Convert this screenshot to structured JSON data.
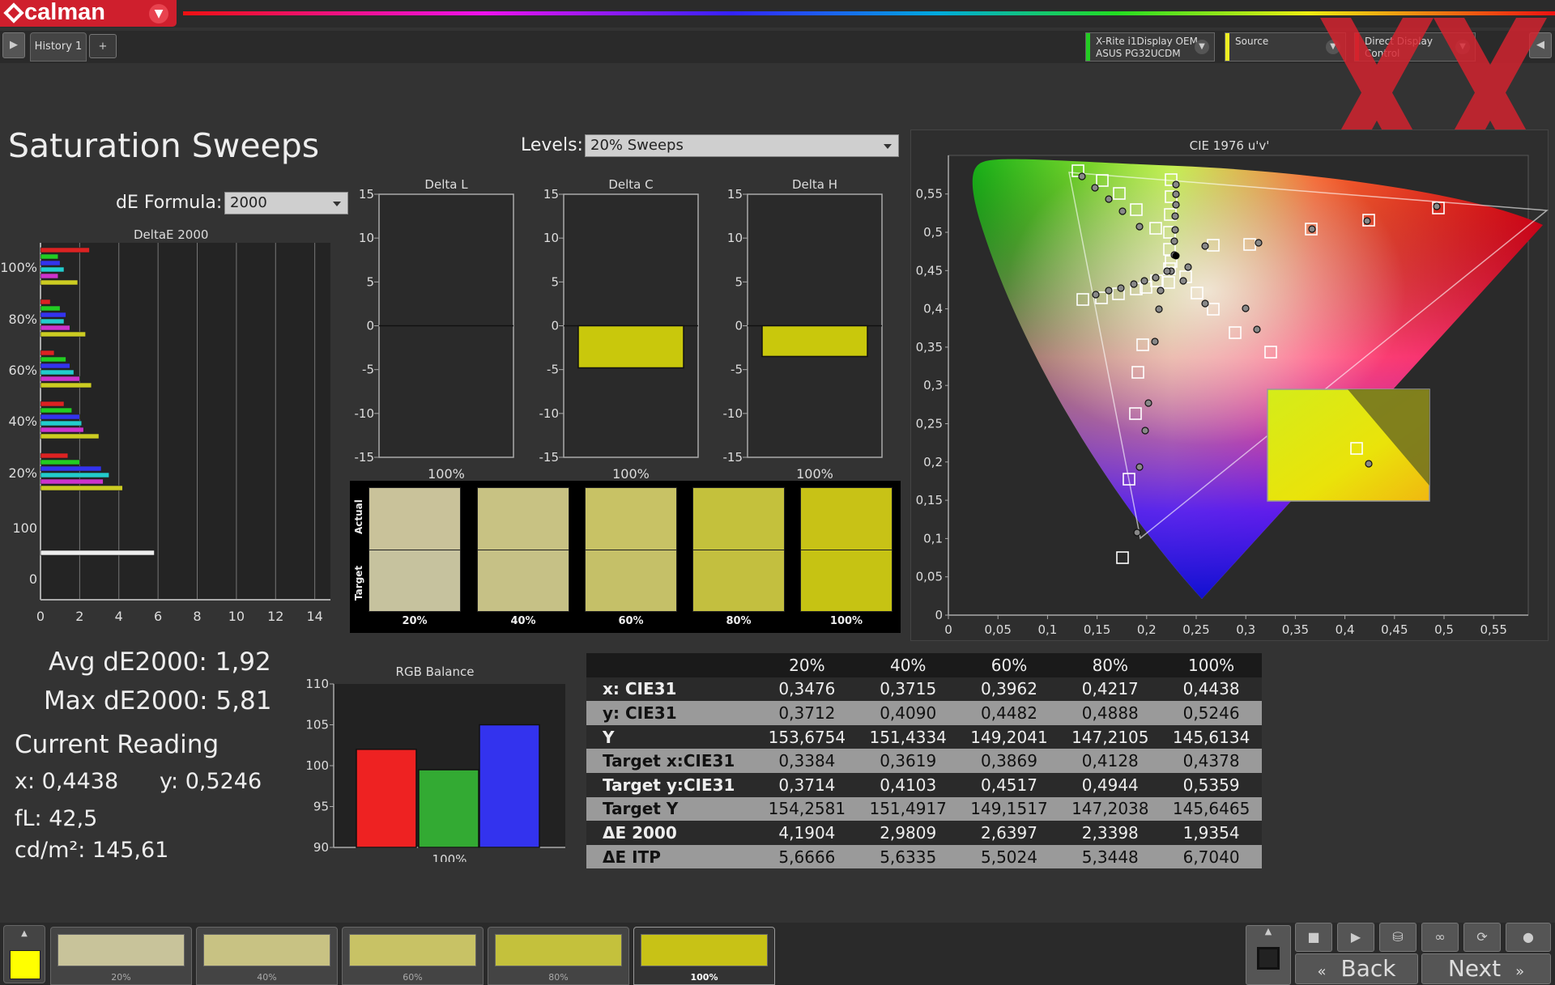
{
  "app": {
    "brand": "calman",
    "tab": "History 1",
    "tab_add": "+"
  },
  "devices": [
    {
      "line1": "X-Rite i1Display OEM",
      "line2": "ASUS PG32UCDM",
      "color": "#22cc22"
    },
    {
      "line1": "Source",
      "line2": "",
      "color": "#e8e81c"
    },
    {
      "line1": "Direct Display Control",
      "line2": "",
      "color": "#cc2222"
    }
  ],
  "page": {
    "title": "Saturation Sweeps",
    "levels_label": "Levels:",
    "levels_value": "20% Sweeps",
    "formula_label": "dE Formula:",
    "formula_value": "2000"
  },
  "deltae_chart": {
    "title": "DeltaE 2000",
    "xticks": [
      "0",
      "2",
      "4",
      "6",
      "8",
      "10",
      "12",
      "14"
    ],
    "ylabels": [
      "100%",
      "80%",
      "60%",
      "40%",
      "20%",
      "100",
      "0"
    ],
    "groups": [
      {
        "label": "100%",
        "values": [
          2.5,
          0.9,
          1.0,
          1.2,
          0.9,
          1.9
        ],
        "colors": [
          "#d22",
          "#2c2",
          "#33e",
          "#2cc",
          "#c3c",
          "#cc2"
        ]
      },
      {
        "label": "80%",
        "values": [
          0.5,
          1.0,
          1.3,
          1.2,
          1.5,
          2.3
        ],
        "colors": [
          "#d22",
          "#2c2",
          "#33e",
          "#2cc",
          "#c3c",
          "#cc2"
        ]
      },
      {
        "label": "60%",
        "values": [
          0.7,
          1.3,
          1.5,
          1.7,
          2.0,
          2.6
        ],
        "colors": [
          "#d22",
          "#2c2",
          "#33e",
          "#2cc",
          "#c3c",
          "#cc2"
        ]
      },
      {
        "label": "40%",
        "values": [
          1.2,
          1.6,
          2.0,
          2.1,
          2.2,
          2.98
        ],
        "colors": [
          "#d22",
          "#2c2",
          "#33e",
          "#2cc",
          "#c3c",
          "#cc2"
        ]
      },
      {
        "label": "20%",
        "values": [
          1.4,
          2.0,
          3.1,
          3.5,
          3.2,
          4.19
        ],
        "colors": [
          "#d22",
          "#2c2",
          "#33e",
          "#2cc",
          "#c3c",
          "#cc2"
        ]
      },
      {
        "label": "100",
        "values": [
          5.81
        ],
        "colors": [
          "#eee"
        ]
      }
    ]
  },
  "delta_charts": [
    {
      "title": "Delta L",
      "value": 0.0,
      "label": "100%"
    },
    {
      "title": "Delta C",
      "value": -4.8,
      "label": "100%"
    },
    {
      "title": "Delta H",
      "value": -3.5,
      "label": "100%"
    }
  ],
  "delta_yticks": [
    "15",
    "10",
    "5",
    "0",
    "-5",
    "-10",
    "-15"
  ],
  "swatches": {
    "actual_label": "Actual",
    "target_label": "Target",
    "items": [
      {
        "label": "20%",
        "actual": "#c9c29a",
        "target": "#c6c29e"
      },
      {
        "label": "40%",
        "actual": "#c8c283",
        "target": "#c6c186"
      },
      {
        "label": "60%",
        "actual": "#c8c265",
        "target": "#c5c068"
      },
      {
        "label": "80%",
        "actual": "#c4c13c",
        "target": "#c3bf3f"
      },
      {
        "label": "100%",
        "actual": "#c8c216",
        "target": "#c6c313"
      }
    ]
  },
  "cie": {
    "title": "CIE 1976 u'v'",
    "xticks": [
      "0",
      "0,05",
      "0,1",
      "0,15",
      "0,2",
      "0,25",
      "0,3",
      "0,35",
      "0,4",
      "0,45",
      "0,5",
      "0,55"
    ],
    "yticks": [
      "0",
      "0,05",
      "0,1",
      "0,15",
      "0,2",
      "0,25",
      "0,3",
      "0,35",
      "0,4",
      "0,45",
      "0,5",
      "0,55"
    ]
  },
  "stats": {
    "avg": "Avg dE2000: 1,92",
    "max": "Max dE2000: 5,81",
    "current": "Current Reading",
    "x": "x: 0,4438",
    "y": "y: 0,5246",
    "fl": "fL: 42,5",
    "cd": "cd/m²: 145,61"
  },
  "rgb_balance": {
    "title": "RGB Balance",
    "yticks": [
      "110",
      "105",
      "100",
      "95",
      "90"
    ],
    "xlabel": "100%",
    "values": [
      {
        "name": "R",
        "value": 102,
        "color": "#e22"
      },
      {
        "name": "G",
        "value": 99.5,
        "color": "#3a3"
      },
      {
        "name": "B",
        "value": 105,
        "color": "#33e"
      }
    ],
    "ylim": [
      90,
      110
    ]
  },
  "table": {
    "headers": [
      "",
      "20%",
      "40%",
      "60%",
      "80%",
      "100%"
    ],
    "rows": [
      [
        "x: CIE31",
        "0,3476",
        "0,3715",
        "0,3962",
        "0,4217",
        "0,4438"
      ],
      [
        "y: CIE31",
        "0,3712",
        "0,4090",
        "0,4482",
        "0,4888",
        "0,5246"
      ],
      [
        "Y",
        "153,6754",
        "151,4334",
        "149,2041",
        "147,2105",
        "145,6134"
      ],
      [
        "Target x:CIE31",
        "0,3384",
        "0,3619",
        "0,3869",
        "0,4128",
        "0,4378"
      ],
      [
        "Target y:CIE31",
        "0,3714",
        "0,4103",
        "0,4517",
        "0,4944",
        "0,5359"
      ],
      [
        "Target Y",
        "154,2581",
        "151,4917",
        "149,1517",
        "147,2038",
        "145,6465"
      ],
      [
        "ΔE 2000",
        "4,1904",
        "2,9809",
        "2,6397",
        "2,3398",
        "1,9354"
      ],
      [
        "ΔE ITP",
        "5,6666",
        "5,6335",
        "5,5024",
        "5,3448",
        "6,7040"
      ]
    ]
  },
  "bottom": {
    "items": [
      {
        "label": "20%",
        "color": "#c8c39a"
      },
      {
        "label": "40%",
        "color": "#c8c283"
      },
      {
        "label": "60%",
        "color": "#c8c265"
      },
      {
        "label": "80%",
        "color": "#c4c13c"
      },
      {
        "label": "100%",
        "color": "#c8c216"
      }
    ],
    "back": "Back",
    "next": "Next"
  }
}
